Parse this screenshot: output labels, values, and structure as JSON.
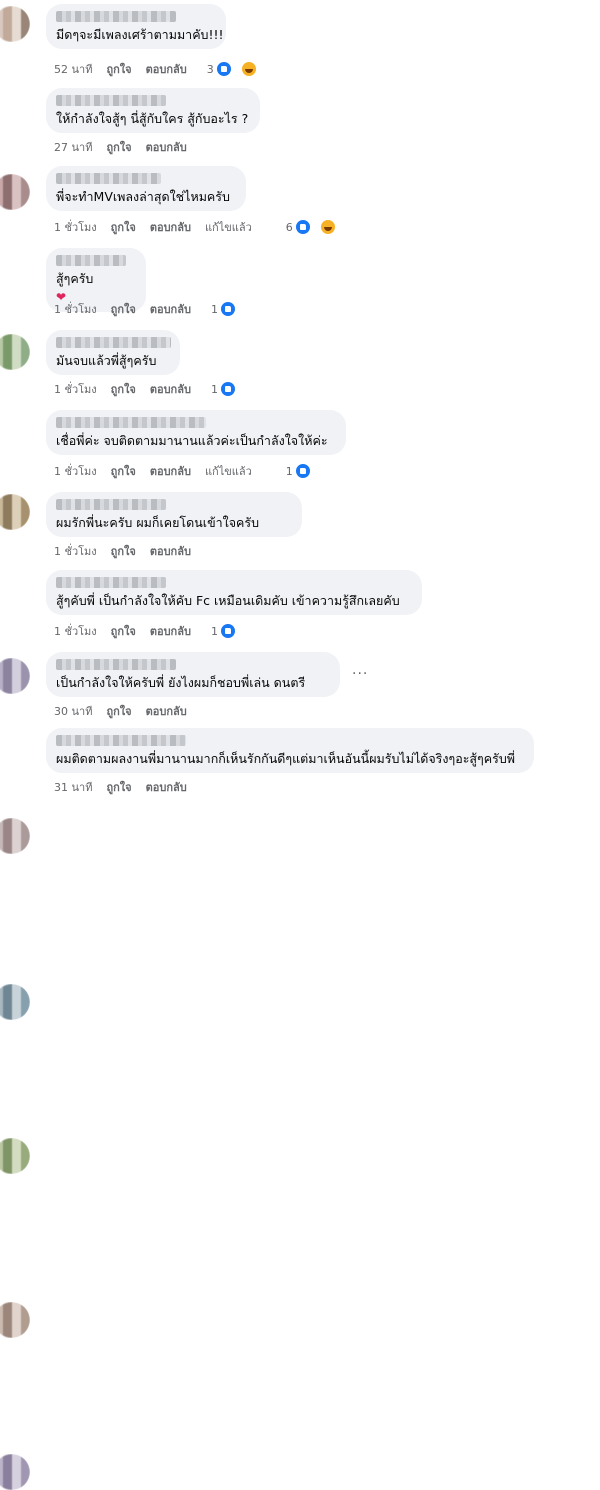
{
  "comments": [
    {
      "text": "มีดๆจะมีเพลงเศร้าตามมาคับ!!!",
      "time": "52 นาที",
      "like": "ถูกใจ",
      "reply": "ตอบกลับ",
      "edited": "",
      "reaction_count": "3",
      "reactions": [
        "like-icon",
        "haha-icon"
      ],
      "avatar_colors": [
        "#d8c8bf",
        "#c2aa9a",
        "#e6dcd3",
        "#9a8678"
      ]
    },
    {
      "text": "ให้กำลังใจสู้ๆ นี่สู้กับใคร สู้กับอะไร ?",
      "time": "27 นาที",
      "like": "ถูกใจ",
      "reply": "ตอบกลับ",
      "edited": "",
      "reaction_count": "",
      "reactions": [],
      "avatar_colors": [
        "#c9a8a8",
        "#8e6f6f",
        "#d9c2c2",
        "#a98d8d"
      ]
    },
    {
      "text": "พี่จะทำMVเพลงล่าสุดใช่ไหมครับ",
      "time": "1 ชั่วโมง",
      "like": "ถูกใจ",
      "reply": "ตอบกลับ",
      "edited": "แก้ไขแล้ว",
      "reaction_count": "6",
      "reactions": [
        "like-icon",
        "haha-icon"
      ],
      "avatar_colors": [
        "#b8c9a6",
        "#7a9a6a",
        "#d0dcc4",
        "#8fae88"
      ]
    },
    {
      "text": "สู้ๆครับ",
      "time": "1 ชั่วโมง",
      "like": "ถูกใจ",
      "reply": "ตอบกลับ",
      "edited": "",
      "reaction_count": "1",
      "reactions": [
        "like-icon"
      ],
      "avatar_colors": [
        "#c9b99a",
        "#8e7a5c",
        "#ddd0b8",
        "#a8916e"
      ]
    },
    {
      "text": "มันจบแล้วพี่สู้ๆครับ",
      "time": "1 ชั่วโมง",
      "like": "ถูกใจ",
      "reply": "ตอบกลับ",
      "edited": "",
      "reaction_count": "1",
      "reactions": [
        "like-icon"
      ],
      "avatar_colors": [
        "#b7b0c6",
        "#8c849f",
        "#d4cfdd",
        "#9b93ad"
      ]
    },
    {
      "text": "เชื่อพี่ค่ะ จบติดตามมานานแล้วค่ะเป็นกำลังใจให้ค่ะ",
      "time": "1 ชั่วโมง",
      "like": "ถูกใจ",
      "reply": "ตอบกลับ",
      "edited": "แก้ไขแล้ว",
      "reaction_count": "1",
      "reactions": [
        "like-icon"
      ],
      "avatar_colors": [
        "#c6b8b8",
        "#9a8686",
        "#ddd2d2",
        "#ab9a9a"
      ]
    },
    {
      "text": "ผมรักพี่นะครับ ผมก็เคยโดนเข้าใจครับ",
      "time": "1 ชั่วโมง",
      "like": "ถูกใจ",
      "reply": "ตอบกลับ",
      "edited": "",
      "reaction_count": "",
      "reactions": [],
      "avatar_colors": [
        "#a8b7c0",
        "#6f8795",
        "#c8d3d9",
        "#86a0ae"
      ]
    },
    {
      "text": "สู้ๆคับพี่ เป็นกำลังใจให้คับ Fc เหมือนเดิมคับ เข้าความรู้สึกเลยคับ",
      "time": "1 ชั่วโมง",
      "like": "ถูกใจ",
      "reply": "ตอบกลับ",
      "edited": "",
      "reaction_count": "1",
      "reactions": [
        "like-icon"
      ],
      "avatar_colors": [
        "#b9c7a2",
        "#7f9566",
        "#d3dcc0",
        "#98ab7c"
      ]
    },
    {
      "text": "เป็นกำลังใจให้ครับพี่ ยังไงผมก็ชอบพี่เล่น ดนตรี",
      "time": "30 นาที",
      "like": "ถูกใจ",
      "reply": "ตอบกลับ",
      "edited": "",
      "reaction_count": "",
      "reactions": [],
      "avatar_colors": [
        "#cbbab0",
        "#9c857a",
        "#e0d4cc",
        "#b19c90"
      ]
    },
    {
      "text": "ผมติดตามผลงานพี่มานานมากก็เห็นรักกันดีๆแต่มาเห็นอันนี้ผมรับไม่ได้จริงๆอะสู้ๆครับพี่",
      "time": "31 นาที",
      "like": "ถูกใจ",
      "reply": "ตอบกลับ",
      "edited": "",
      "reaction_count": "",
      "reactions": [],
      "avatar_colors": [
        "#bcb4c9",
        "#8a7f9c",
        "#d6d1df",
        "#a197b3"
      ]
    }
  ],
  "more_options": "···"
}
